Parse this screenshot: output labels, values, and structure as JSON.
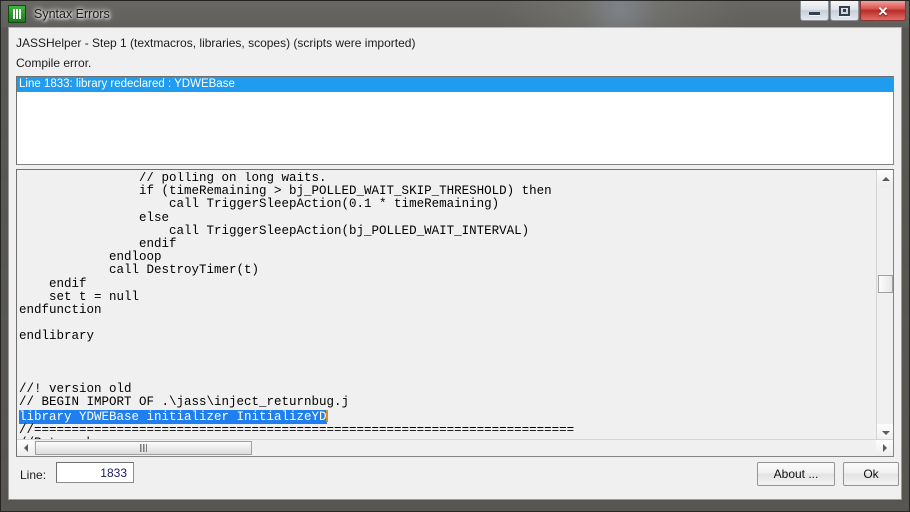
{
  "window": {
    "title": "Syntax Errors",
    "icon": "jasshelper-icon",
    "controls": {
      "minimize": "minimize-icon",
      "maximize": "restore-icon",
      "close": "✕"
    }
  },
  "header": {
    "status_line": "JASSHelper - Step 1 (textmacros, libraries, scopes) (scripts were imported)",
    "error_summary": "Compile error."
  },
  "error_list": {
    "items": [
      {
        "text": "Line 1833: library redeclared : YDWEBase",
        "selected": true
      }
    ],
    "selection_color": "#1f9bf0"
  },
  "code_view": {
    "lines_before": "                // polling on long waits.\n                if (timeRemaining > bj_POLLED_WAIT_SKIP_THRESHOLD) then\n                    call TriggerSleepAction(0.1 * timeRemaining)\n                else\n                    call TriggerSleepAction(bj_POLLED_WAIT_INTERVAL)\n                endif\n            endloop\n            call DestroyTimer(t)\n    endif\n    set t = null\nendfunction\n\nendlibrary\n\n\n\n//! version old\n// BEGIN IMPORT OF .\\jass\\inject_returnbug.j\n",
    "selected_line": "library YDWEBase initializer InitializeYD",
    "lines_after": "\n//========================================================================\n//Return bug",
    "selection_bg": "#1f7ff0",
    "caret_color": "#d98c20"
  },
  "footer": {
    "line_label": "Line:",
    "line_value": "1833",
    "about_label": "About ...",
    "ok_label": "Ok"
  },
  "scrollbars": {
    "vertical": {
      "up": "scroll-up-icon",
      "down": "scroll-down-icon"
    },
    "horizontal": {
      "left": "scroll-left-icon",
      "right": "scroll-right-icon"
    }
  }
}
